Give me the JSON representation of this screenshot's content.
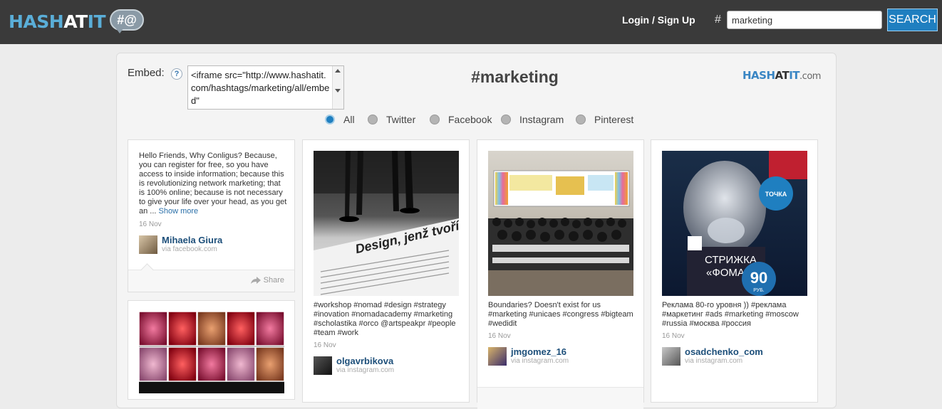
{
  "header": {
    "logo": {
      "hash": "HASH",
      "at": "AT",
      "it": "IT",
      "bubble": "#@"
    },
    "login_label": "Login / Sign Up",
    "hash_symbol": "#",
    "search_value": "marketing",
    "search_button": "SEARCH"
  },
  "embed": {
    "label": "Embed:",
    "help": "?",
    "code": "<iframe src=\"http://www.hashatit.com/hashtags/marketing/all/embed\""
  },
  "page": {
    "title": "#marketing",
    "brand": {
      "hash": "HASH",
      "at": "AT",
      "it": "IT",
      "com": ".com"
    }
  },
  "filters": [
    {
      "label": "All",
      "selected": true
    },
    {
      "label": "Twitter",
      "selected": false
    },
    {
      "label": "Facebook",
      "selected": false
    },
    {
      "label": "Instagram",
      "selected": false
    },
    {
      "label": "Pinterest",
      "selected": false
    }
  ],
  "posts": [
    {
      "text": "Hello Friends, Why Conligus? Because, you can register for free, so you have access to inside information; because this is revolutionizing network marketing; that is 100% online; because is not necessary to give your life over your head, as you get an ...",
      "show_more": "Show more",
      "date": "16 Nov",
      "author": "Mihaela Giura",
      "via": "via facebook.com",
      "share": "Share"
    },
    {
      "text": "#workshop #nomad #design #strategy #inovation #nomadacademy #marketing #scholastika #orco @artspeakpr #people #team #work",
      "date": "16 Nov",
      "author": "olgavrbikova",
      "via": "via instagram.com",
      "photo_caption": "Design, jenž tvoří „ted\""
    },
    {
      "text": "Boundaries? Doesn't exist for us #marketing #unicaes #congress #bigteam #wedidit",
      "date": "16 Nov",
      "author": "jmgomez_16",
      "via": "via instagram.com"
    },
    {
      "text": "Реклама 80-го уровня )) #реклама #маркетинг #ads #marketing #moscow #russia #москва #россия",
      "date": "16 Nov",
      "author": "osadchenko_com",
      "via": "via instagram.com",
      "photo_caption": {
        "line1": "СТРИЖКА",
        "line2": "«ФОМА»",
        "price": "90",
        "unit": "РУБ.",
        "badge": "ТОЧКА"
      }
    }
  ]
}
